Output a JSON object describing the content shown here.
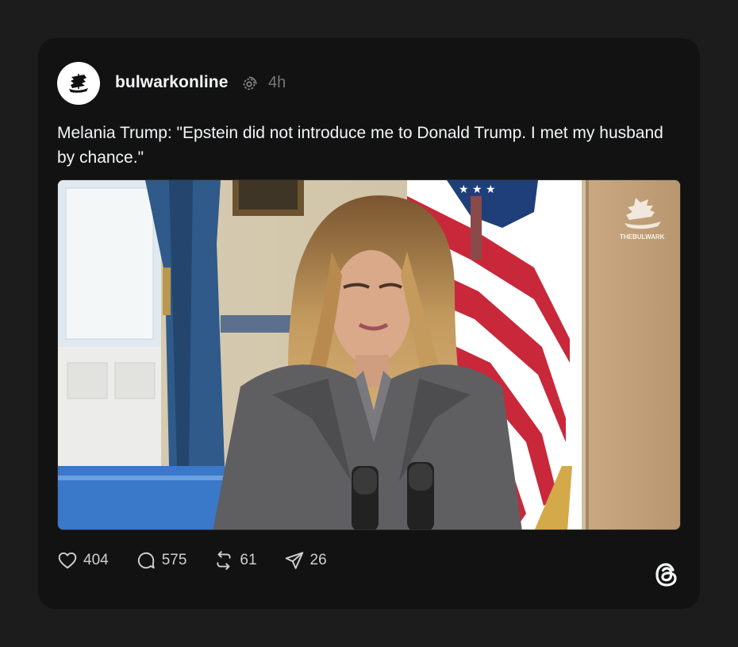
{
  "post": {
    "username": "bulwarkonline",
    "time": "4h",
    "text": "Melania Trump: \"Epstein did not introduce me to Donald Trump. I met my husband by chance.\"",
    "avatar_icon": "ship-logo-icon",
    "media": {
      "watermark": "THEBULWARK"
    }
  },
  "actions": {
    "likes": "404",
    "replies": "575",
    "reposts": "61",
    "shares": "26"
  },
  "colors": {
    "background": "#1c1c1c",
    "card": "#121212",
    "text": "#f3f5f7",
    "muted": "#777777"
  }
}
